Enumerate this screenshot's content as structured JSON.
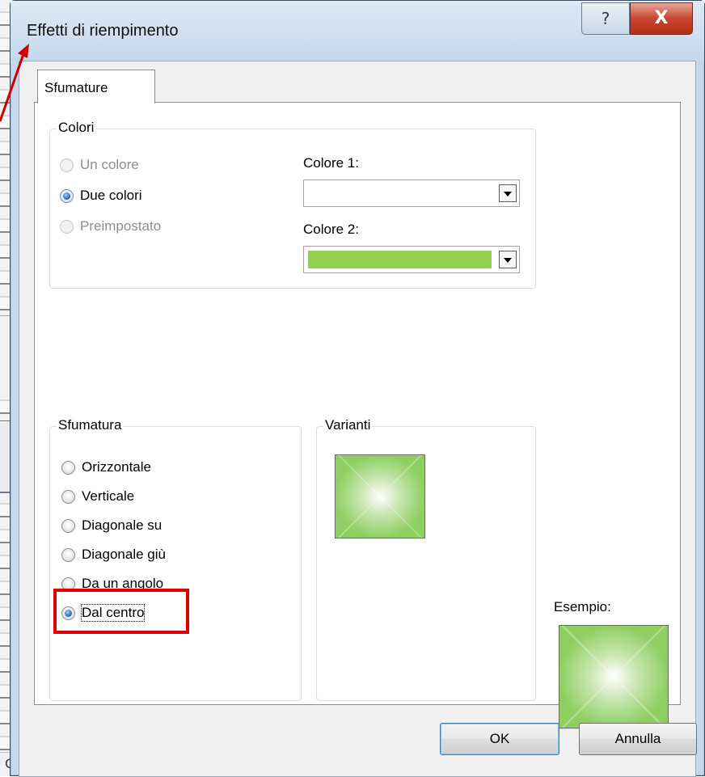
{
  "dialog": {
    "title": "Effetti di riempimento",
    "help_label": "?",
    "close_label": "X"
  },
  "tab": {
    "label": "Sfumature"
  },
  "colors_group": {
    "label": "Colori",
    "options": [
      {
        "label": "Un colore",
        "state": "disabled"
      },
      {
        "label": "Due colori",
        "state": "checked"
      },
      {
        "label": "Preimpostato",
        "state": "disabled"
      }
    ],
    "color1_label": "Colore 1:",
    "color1_value": "#ffffff",
    "color2_label": "Colore 2:",
    "color2_value": "#92d050"
  },
  "shading_group": {
    "label": "Sfumatura",
    "options": [
      {
        "label": "Orizzontale",
        "checked": false
      },
      {
        "label": "Verticale",
        "checked": false
      },
      {
        "label": "Diagonale su",
        "checked": false
      },
      {
        "label": "Diagonale giù",
        "checked": false
      },
      {
        "label": "Da un angolo",
        "checked": false
      },
      {
        "label": "Dal centro",
        "checked": true
      }
    ]
  },
  "variants_group": {
    "label": "Varianti"
  },
  "sample": {
    "label": "Esempio:"
  },
  "buttons": {
    "ok": "OK",
    "cancel": "Annulla"
  },
  "background": {
    "cell_label": "G"
  },
  "colors": {
    "highlight": "#e00000",
    "gradient_outer": "#8fcf62",
    "gradient_center": "#ffffff"
  }
}
